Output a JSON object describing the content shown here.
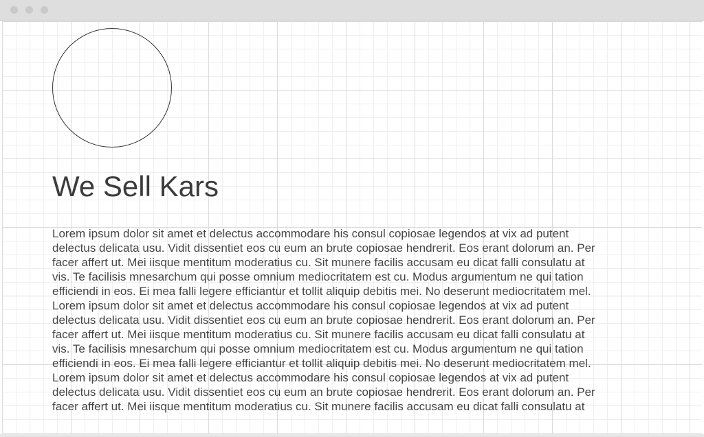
{
  "window": {
    "controls": [
      "close-dot-icon",
      "minimize-dot-icon",
      "maximize-dot-icon"
    ]
  },
  "logo": {
    "shape": "circle-placeholder"
  },
  "heading": "We Sell Kars",
  "body_lines": [
    "Lorem ipsum dolor sit amet et delectus accommodare his consul copiosae legendos at vix ad putent",
    "delectus delicata usu. Vidit dissentiet eos cu eum an brute copiosae hendrerit. Eos erant dolorum an. Per",
    "facer affert ut. Mei iisque mentitum moderatius cu. Sit munere facilis accusam eu dicat falli consulatu at",
    "vis. Te facilisis mnesarchum qui posse omnium mediocritatem est cu. Modus argumentum ne qui tation",
    "efficiendi in eos. Ei mea falli legere efficiantur et tollit aliquip debitis mei. No deserunt mediocritatem mel.",
    "Lorem ipsum dolor sit amet et delectus accommodare his consul copiosae legendos at vix ad putent",
    "delectus delicata usu. Vidit dissentiet eos cu eum an brute copiosae hendrerit. Eos erant dolorum an. Per",
    "facer affert ut. Mei iisque mentitum moderatius cu. Sit munere facilis accusam eu dicat falli consulatu at",
    "vis. Te facilisis mnesarchum qui posse omnium mediocritatem est cu. Modus argumentum ne qui tation",
    "efficiendi in eos. Ei mea falli legere efficiantur et tollit aliquip debitis mei. No deserunt mediocritatem mel.",
    "Lorem ipsum dolor sit amet et delectus accommodare his consul copiosae legendos at vix ad putent",
    "delectus delicata usu. Vidit dissentiet eos cu eum an brute copiosae hendrerit. Eos erant dolorum an. Per",
    "facer affert ut. Mei iisque mentitum moderatius cu. Sit munere facilis accusam eu dicat falli consulatu at"
  ],
  "colors": {
    "titlebar": "#dedede",
    "window_dot": "#c9c9c9",
    "grid_major": "#dcdcdc",
    "grid_minor": "#efefef",
    "heading_text": "#3b3b3b",
    "body_text": "#454545"
  }
}
